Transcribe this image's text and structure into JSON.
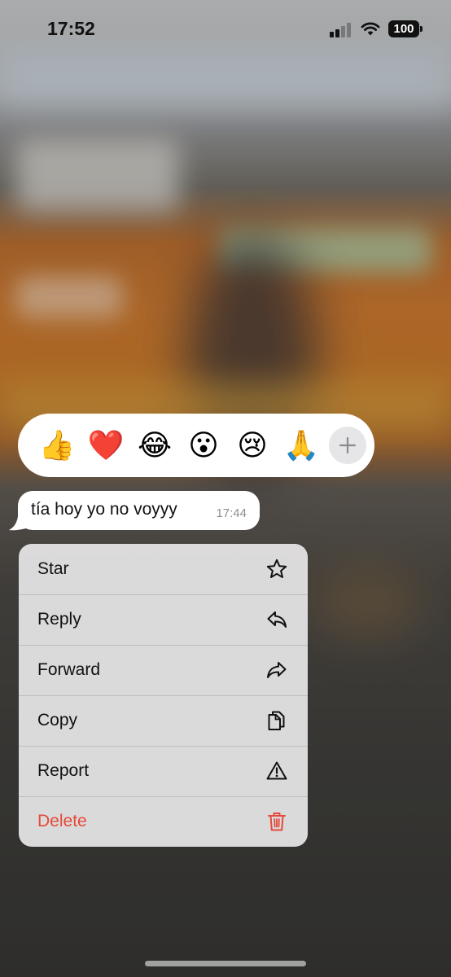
{
  "status_bar": {
    "time": "17:52",
    "battery": "100",
    "signal_bars_active": 2,
    "signal_bars_total": 4
  },
  "reactions": [
    {
      "emoji": "👍",
      "icon": "thumbs-up-icon"
    },
    {
      "emoji": "❤️",
      "icon": "red-heart-icon"
    },
    {
      "emoji": "😂",
      "icon": "tears-of-joy-icon"
    },
    {
      "emoji": "😮",
      "icon": "open-mouth-icon"
    },
    {
      "emoji": "😢",
      "icon": "crying-face-icon"
    },
    {
      "emoji": "🙏",
      "icon": "folded-hands-icon"
    }
  ],
  "add_reaction_icon": "plus-icon",
  "message": {
    "text": "tía hoy yo no voyyy",
    "time": "17:44"
  },
  "menu": {
    "items": [
      {
        "label": "Star",
        "icon": "star-icon"
      },
      {
        "label": "Reply",
        "icon": "reply-icon"
      },
      {
        "label": "Forward",
        "icon": "forward-icon"
      },
      {
        "label": "Copy",
        "icon": "copy-icon"
      },
      {
        "label": "Report",
        "icon": "warning-icon"
      },
      {
        "label": "Delete",
        "icon": "trash-icon",
        "destructive": true
      }
    ]
  },
  "colors": {
    "destructive": "#e5493a",
    "text": "#111111",
    "menu_background": "#e2e1e2"
  }
}
